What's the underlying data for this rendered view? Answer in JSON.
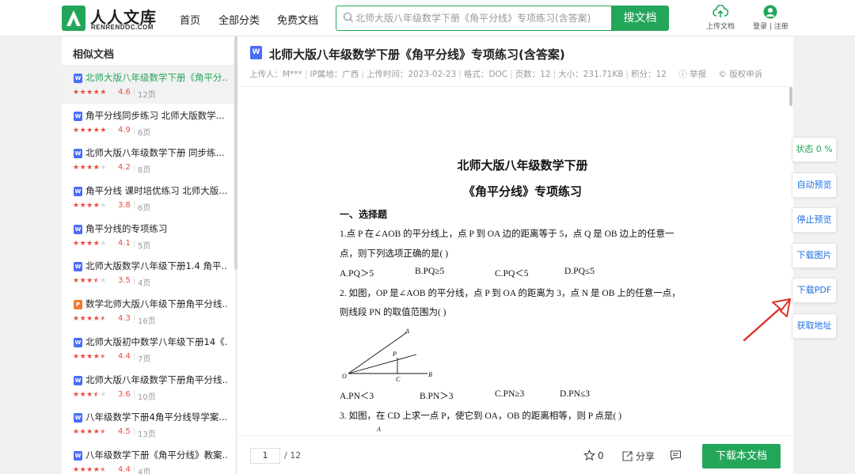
{
  "header": {
    "logo_text": "人人文库",
    "logo_sub": "RENRENDOC.COM",
    "nav": [
      "首页",
      "全部分类",
      "免费文档"
    ],
    "search_placeholder": "北师大版八年级数学下册《角平分线》专项练习(含答案)",
    "search_button": "搜文档",
    "upload_label": "上传文档",
    "login_label": "登录 | 注册"
  },
  "sidebar": {
    "title": "相似文档",
    "items": [
      {
        "title": "北师大版八年级数学下册《角平分...",
        "score": "4.6",
        "pages": "12页",
        "type": "W",
        "stars": 5
      },
      {
        "title": "角平分线同步练习 北师大版数学...",
        "score": "4.9",
        "pages": "6页",
        "type": "W",
        "stars": 5
      },
      {
        "title": "北师大版八年级数学下册 同步练...",
        "score": "4.2",
        "pages": "8页",
        "type": "W",
        "stars": 4
      },
      {
        "title": "角平分线 课时培优练习 北师大版...",
        "score": "3.8",
        "pages": "6页",
        "type": "W",
        "stars": 4
      },
      {
        "title": "角平分线的专项练习",
        "score": "4.1",
        "pages": "5页",
        "type": "W",
        "stars": 4
      },
      {
        "title": "北师大版数学八年级下册1.4 角平...",
        "score": "3.5",
        "pages": "4页",
        "type": "W",
        "stars": 3.5
      },
      {
        "title": "数学北师大版八年级下册角平分线...",
        "score": "4.3",
        "pages": "16页",
        "type": "P",
        "stars": 4.5
      },
      {
        "title": "北师大版初中数学八年级下册14《...",
        "score": "4.4",
        "pages": "7页",
        "type": "W",
        "stars": 4.5
      },
      {
        "title": "北师大版八年级数学下册角平分线...",
        "score": "3.6",
        "pages": "10页",
        "type": "W",
        "stars": 3.5
      },
      {
        "title": "八年级数学下册4角平分线导学案...",
        "score": "4.5",
        "pages": "13页",
        "type": "W",
        "stars": 4.5
      },
      {
        "title": "八年级数学下册《角平分线》教案...",
        "score": "4.4",
        "pages": "4页",
        "type": "W",
        "stars": 4.5
      }
    ]
  },
  "document": {
    "title": "北师大版八年级数学下册《角平分线》专项练习(含答案)",
    "meta": {
      "uploader": "上传人：M***",
      "ip": "IP属地：广西",
      "upload_time": "上传时间：2023-02-23",
      "format": "格式：DOC",
      "pages": "页数：12",
      "size": "大小：231.71KB",
      "points": "积分：12",
      "report": "举报",
      "copyright": "版权申诉"
    },
    "paper": {
      "heading1": "北师大版八年级数学下册",
      "heading2": "《角平分线》专项练习",
      "section": "一、选择题",
      "q1_line1": "1.点 P 在∠AOB 的平分线上，点 P 到 OA 边的距离等于 5，点 Q 是 OB 边上的任意一",
      "q1_line2": "点，则下列选项正确的是(      )",
      "q1_opts": [
        "A.PQ＞5",
        "B.PQ≥5",
        "C.PQ＜5",
        "D.PQ≤5"
      ],
      "q2_line1": "2. 如图，OP 是∠AOB 的平分线，点 P 到 OA 的距离为 3，点 N 是 OB 上的任意一点，",
      "q2_line2": "则线段 PN 的取值范围为(          )",
      "q2_opts": [
        "A.PN＜3",
        "B.PN＞3",
        "C.PN≥3",
        "D.PN≤3"
      ],
      "q3_line1": "3. 如图，在 CD 上求一点 P，使它到 OA，OB 的距离相等，则 P 点是(          )",
      "figure_labels": {
        "A": "A",
        "P": "P",
        "O": "O",
        "C": "C",
        "B": "B",
        "small": "A"
      }
    }
  },
  "pagination": {
    "current": "1",
    "total": "/ 12"
  },
  "bottom_actions": {
    "favorite_count": "0",
    "share": "分享",
    "download_button": "下载本文档"
  },
  "float_buttons": [
    "状态 0 %",
    "自动预览",
    "停止预览",
    "下载图片",
    "下载PDF",
    "获取地址"
  ],
  "colors": {
    "brand_green": "#24a65a",
    "link_blue": "#1f6fe0",
    "star_red": "#e94c3d",
    "arrow_red": "#e0312b"
  }
}
